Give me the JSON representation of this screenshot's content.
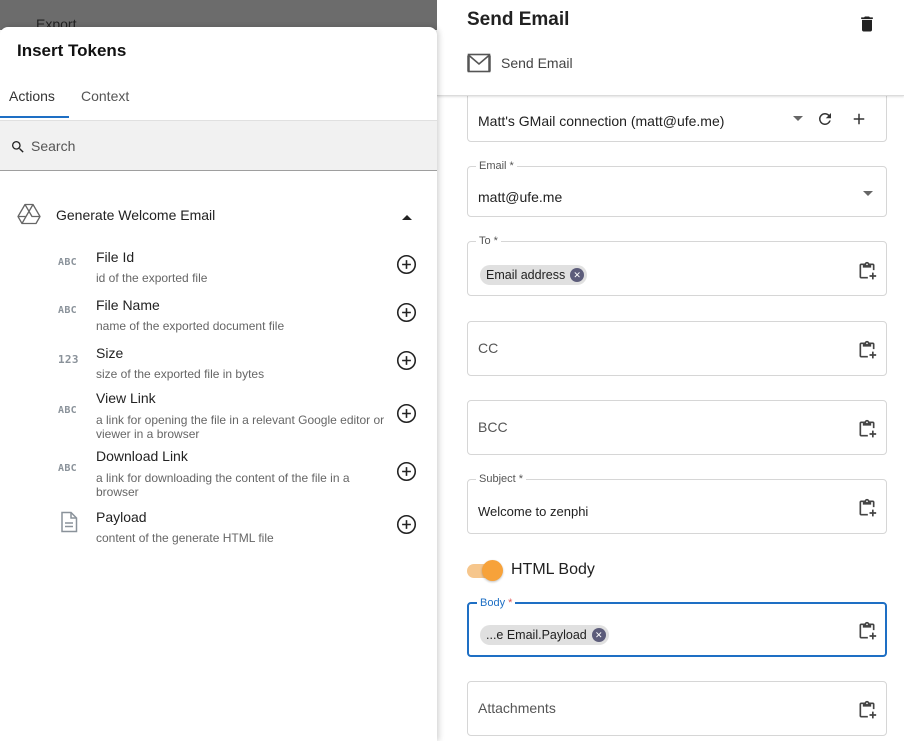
{
  "background": {
    "dim_text": "Export"
  },
  "insert_tokens": {
    "title": "Insert Tokens",
    "tabs": [
      {
        "label": "Actions",
        "active": true
      },
      {
        "label": "Context",
        "active": false
      }
    ],
    "search": {
      "placeholder": "Search",
      "value": ""
    },
    "group": {
      "title": "Generate Welcome Email",
      "icon": "google-drive-icon",
      "expanded": true,
      "tokens": [
        {
          "type_badge": "ABC",
          "name": "File Id",
          "description": "id of the exported file"
        },
        {
          "type_badge": "ABC",
          "name": "File Name",
          "description": "name of the exported document file"
        },
        {
          "type_badge": "123",
          "name": "Size",
          "description": "size of the exported file in bytes"
        },
        {
          "type_badge": "ABC",
          "name": "View Link",
          "description": "a link for opening the file in a relevant Google editor or viewer in a browser"
        },
        {
          "type_badge": "ABC",
          "name": "Download Link",
          "description": "a link for downloading the content of the file in a browser"
        },
        {
          "type_badge": "document-icon",
          "name": "Payload",
          "description": "content of the generate HTML file"
        }
      ]
    }
  },
  "send_email": {
    "title": "Send Email",
    "subtitle": "Send Email",
    "connection": {
      "value": "Matt's GMail connection (matt@ufe.me)"
    },
    "email": {
      "label": "Email *",
      "value": "matt@ufe.me"
    },
    "to": {
      "label": "To *",
      "chip": "Email address"
    },
    "cc": {
      "placeholder": "CC"
    },
    "bcc": {
      "placeholder": "BCC"
    },
    "subject": {
      "label": "Subject *",
      "value": "Welcome to zenphi"
    },
    "html_body": {
      "label": "HTML Body",
      "enabled": true
    },
    "body": {
      "label": "Body",
      "required_mark": "*",
      "chip": "...e Email.Payload"
    },
    "attachments": {
      "placeholder": "Attachments"
    }
  },
  "colors": {
    "accent_blue": "#1e6fc4",
    "toggle_orange": "#f7a23a",
    "chip_bg": "#e0e0e0"
  }
}
